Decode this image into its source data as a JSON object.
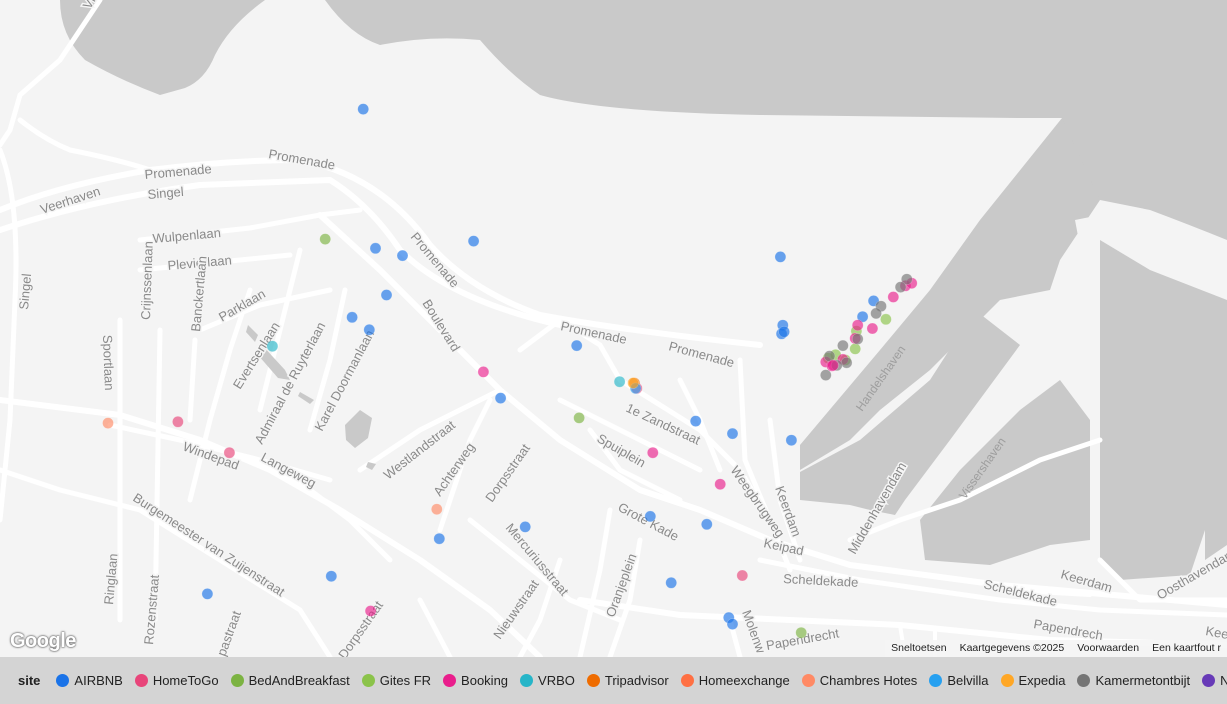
{
  "map": {
    "streets": [
      {
        "name": "Vlissingen",
        "text": "Vlis"
      },
      {
        "name": "Veerhaven",
        "text": "Veerhaven"
      },
      {
        "name": "Promenade-1",
        "text": "Promenade"
      },
      {
        "name": "Promenade-2",
        "text": "Promenade"
      },
      {
        "name": "Singel-1",
        "text": "Singel"
      },
      {
        "name": "Singel-2",
        "text": "Singel"
      },
      {
        "name": "Wulpenlaan",
        "text": "Wulpenlaan"
      },
      {
        "name": "Plevierlaan",
        "text": "Plevierlaan"
      },
      {
        "name": "Parklaan",
        "text": "Parklaan"
      },
      {
        "name": "Promenade-3",
        "text": "Promenade"
      },
      {
        "name": "Promenade-4",
        "text": "Promenade"
      },
      {
        "name": "Promenade-5",
        "text": "Promenade"
      },
      {
        "name": "Boulevard",
        "text": "Boulevard"
      },
      {
        "name": "Evertsenlaan",
        "text": "Evertsenlaan"
      },
      {
        "name": "Admiraal-de-Ruyterlaan",
        "text": "Admiraal de Ruyterlaan"
      },
      {
        "name": "Karel-Doormanlaan",
        "text": "Karel Doormanlaan"
      },
      {
        "name": "Sportlaan",
        "text": "Sportlaan"
      },
      {
        "name": "Crijnssenlaan",
        "text": "Crijnssenlaan"
      },
      {
        "name": "Banckertlaan",
        "text": "Banckertlaan"
      },
      {
        "name": "Windepad",
        "text": "Windepad"
      },
      {
        "name": "Langeweg",
        "text": "Langeweg"
      },
      {
        "name": "Westlandstraat",
        "text": "Westlandstraat"
      },
      {
        "name": "Achterweg",
        "text": "Achterweg"
      },
      {
        "name": "Dorpsstraat-1",
        "text": "Dorpsstraat"
      },
      {
        "name": "1e-Zandstraat",
        "text": "1e Zandstraat"
      },
      {
        "name": "Spuiplein",
        "text": "Spuiplein"
      },
      {
        "name": "Weegbrugweg",
        "text": "Weegbrugweg"
      },
      {
        "name": "Keerdam-1",
        "text": "Keerdam"
      },
      {
        "name": "Grote-Kade",
        "text": "Grote Kade"
      },
      {
        "name": "Keipad",
        "text": "Keipad"
      },
      {
        "name": "Middenhavendam",
        "text": "Middenhavendam"
      },
      {
        "name": "Scheldekade-1",
        "text": "Scheldekade"
      },
      {
        "name": "Scheldekade-2",
        "text": "Scheldekade"
      },
      {
        "name": "Keerdam-2",
        "text": "Keerdam"
      },
      {
        "name": "Oosthavendam",
        "text": "Oosthavendam"
      },
      {
        "name": "Burgemeester-van-Zuijenstraat",
        "text": "Burgemeester van Zuijenstraat"
      },
      {
        "name": "Ringlaan",
        "text": "Ringlaan"
      },
      {
        "name": "Rozenstraat",
        "text": "Rozenstraat"
      },
      {
        "name": "Lupastraat",
        "text": "pastraat"
      },
      {
        "name": "Dorpsstraat-2",
        "text": "Dorpsstraat"
      },
      {
        "name": "Mercuriusstraat",
        "text": "Mercuriusstraat"
      },
      {
        "name": "Nieuwstraat",
        "text": "Nieuwstraat"
      },
      {
        "name": "Oranjeplein",
        "text": "Oranjeplein"
      },
      {
        "name": "Molenweg",
        "text": "Molenw"
      },
      {
        "name": "Papendrecht-1",
        "text": "Papendrecht"
      },
      {
        "name": "Papendrecht-2",
        "text": "Papendrech"
      },
      {
        "name": "Kee",
        "text": "Kee"
      },
      {
        "name": "Handelshaven",
        "text": "Handelshaven"
      },
      {
        "name": "Vissershaven",
        "text": "Vissershaven"
      }
    ],
    "points": [
      {
        "site": "AIRBNB",
        "lat": 0.166,
        "lng": 0.296
      },
      {
        "site": "AIRBNB",
        "lat": 0.378,
        "lng": 0.306
      },
      {
        "site": "AIRBNB",
        "lat": 0.389,
        "lng": 0.328
      },
      {
        "site": "AIRBNB",
        "lat": 0.367,
        "lng": 0.386
      },
      {
        "site": "AIRBNB",
        "lat": 0.449,
        "lng": 0.315
      },
      {
        "site": "AIRBNB",
        "lat": 0.483,
        "lng": 0.287
      },
      {
        "site": "AIRBNB",
        "lat": 0.502,
        "lng": 0.301
      },
      {
        "site": "AIRBNB",
        "lat": 0.526,
        "lng": 0.47
      },
      {
        "site": "AIRBNB",
        "lat": 0.606,
        "lng": 0.408
      },
      {
        "site": "AIRBNB",
        "lat": 0.391,
        "lng": 0.636
      },
      {
        "site": "AIRBNB",
        "lat": 0.495,
        "lng": 0.638
      },
      {
        "site": "AIRBNB",
        "lat": 0.508,
        "lng": 0.637
      },
      {
        "site": "AIRBNB",
        "lat": 0.505,
        "lng": 0.639
      },
      {
        "site": "AIRBNB",
        "lat": 0.458,
        "lng": 0.712
      },
      {
        "site": "AIRBNB",
        "lat": 0.482,
        "lng": 0.703
      },
      {
        "site": "AIRBNB",
        "lat": 0.641,
        "lng": 0.567
      },
      {
        "site": "AIRBNB",
        "lat": 0.66,
        "lng": 0.597
      },
      {
        "site": "AIRBNB",
        "lat": 0.67,
        "lng": 0.645
      },
      {
        "site": "AIRBNB",
        "lat": 0.786,
        "lng": 0.53
      },
      {
        "site": "AIRBNB",
        "lat": 0.798,
        "lng": 0.576
      },
      {
        "site": "AIRBNB",
        "lat": 0.802,
        "lng": 0.428
      },
      {
        "site": "AIRBNB",
        "lat": 0.82,
        "lng": 0.358
      },
      {
        "site": "AIRBNB",
        "lat": 0.877,
        "lng": 0.27
      },
      {
        "site": "AIRBNB",
        "lat": 0.904,
        "lng": 0.169
      },
      {
        "site": "AIRBNB",
        "lat": 0.887,
        "lng": 0.547
      },
      {
        "site": "AIRBNB",
        "lat": 0.94,
        "lng": 0.594
      },
      {
        "site": "AIRBNB",
        "lat": 0.95,
        "lng": 0.597
      },
      {
        "site": "HomeToGo",
        "lat": 0.642,
        "lng": 0.145
      },
      {
        "site": "HomeToGo",
        "lat": 0.689,
        "lng": 0.187
      },
      {
        "site": "HomeToGo",
        "lat": 0.591,
        "lng": 0.519
      },
      {
        "site": "HomeToGo",
        "lat": 0.876,
        "lng": 0.605
      },
      {
        "site": "BedAndBreakfast",
        "lat": 0.364,
        "lng": 0.265
      },
      {
        "site": "BedAndBreakfast",
        "lat": 0.636,
        "lng": 0.472
      },
      {
        "site": "BedAndBreakfast",
        "lat": 0.963,
        "lng": 0.653
      },
      {
        "site": "Booking",
        "lat": 0.737,
        "lng": 0.587
      },
      {
        "site": "Booking",
        "lat": 0.93,
        "lng": 0.302
      },
      {
        "site": "Booking",
        "lat": 0.566,
        "lng": 0.394
      },
      {
        "site": "Booking",
        "lat": 0.689,
        "lng": 0.532
      },
      {
        "site": "VRBO",
        "lat": 0.527,
        "lng": 0.222
      },
      {
        "site": "VRBO",
        "lat": 0.581,
        "lng": 0.505
      },
      {
        "site": "Tripadvisor",
        "lat": 0.583,
        "lng": 0.517
      },
      {
        "site": "Chambres Hotes",
        "lat": 0.644,
        "lng": 0.088
      },
      {
        "site": "Chambres Hotes",
        "lat": 0.775,
        "lng": 0.356
      },
      {
        "site": "Belvilla",
        "lat": 0.591,
        "lng": 0.518
      },
      {
        "site": "Gites FR",
        "lat": 0.486,
        "lng": 0.722
      },
      {
        "site": "Gites FR",
        "lat": 0.531,
        "lng": 0.697
      },
      {
        "site": "Gites FR",
        "lat": 0.548,
        "lng": 0.689
      },
      {
        "site": "Gites FR",
        "lat": 0.504,
        "lng": 0.698
      },
      {
        "site": "Gites FR",
        "lat": 0.545,
        "lng": 0.675
      },
      {
        "site": "Gites FR",
        "lat": 0.54,
        "lng": 0.681
      },
      {
        "site": "Booking",
        "lat": 0.435,
        "lng": 0.738
      },
      {
        "site": "Booking",
        "lat": 0.452,
        "lng": 0.728
      },
      {
        "site": "Booking",
        "lat": 0.495,
        "lng": 0.699
      },
      {
        "site": "Booking",
        "lat": 0.515,
        "lng": 0.697
      },
      {
        "site": "Booking",
        "lat": 0.551,
        "lng": 0.673
      },
      {
        "site": "Booking",
        "lat": 0.557,
        "lng": 0.678
      },
      {
        "site": "Booking",
        "lat": 0.547,
        "lng": 0.687
      },
      {
        "site": "Booking",
        "lat": 0.431,
        "lng": 0.743
      },
      {
        "site": "Kamermetontbijt",
        "lat": 0.425,
        "lng": 0.739
      },
      {
        "site": "Kamermetontbijt",
        "lat": 0.437,
        "lng": 0.734
      },
      {
        "site": "Kamermetontbijt",
        "lat": 0.466,
        "lng": 0.718
      },
      {
        "site": "Kamermetontbijt",
        "lat": 0.477,
        "lng": 0.714
      },
      {
        "site": "Kamermetontbijt",
        "lat": 0.516,
        "lng": 0.699
      },
      {
        "site": "Kamermetontbijt",
        "lat": 0.526,
        "lng": 0.687
      },
      {
        "site": "Kamermetontbijt",
        "lat": 0.542,
        "lng": 0.676
      },
      {
        "site": "Kamermetontbijt",
        "lat": 0.552,
        "lng": 0.69
      },
      {
        "site": "Kamermetontbijt",
        "lat": 0.571,
        "lng": 0.673
      },
      {
        "site": "Kamermetontbijt",
        "lat": 0.556,
        "lng": 0.682
      },
      {
        "site": "Expedia",
        "lat": 0.583,
        "lng": 0.516
      },
      {
        "site": "Booking",
        "lat": 0.5,
        "lng": 0.711
      },
      {
        "site": "Booking",
        "lat": 0.556,
        "lng": 0.679
      }
    ]
  },
  "colors": {
    "AIRBNB": "#1a73e8",
    "HomeToGo": "#e8457a",
    "BedAndBreakfast": "#7cb342",
    "Gites FR": "#8bc34a",
    "Booking": "#e91e8c",
    "VRBO": "#26b5c8",
    "Tripadvisor": "#ef6c00",
    "Homeexchange": "#ff7043",
    "Chambres Hotes": "#ff8a65",
    "Belvilla": "#26a0f0",
    "Expedia": "#ffa726",
    "Kamermetontbijt": "#757575",
    "Natuurhuisje": "#673ab7",
    "blend_red": "#c0504d",
    "blend_olive": "#8d8d44"
  },
  "google_logo": "Google",
  "attribution": {
    "shortcuts": "Sneltoetsen",
    "mapdata": "Kaartgegevens ©2025",
    "terms": "Voorwaarden",
    "report": "Een kaartfout r"
  },
  "legend": {
    "title": "site",
    "items": [
      {
        "label": "AIRBNB",
        "key": "AIRBNB"
      },
      {
        "label": "HomeToGo",
        "key": "HomeToGo"
      },
      {
        "label": "BedAndBreakfast",
        "key": "BedAndBreakfast"
      },
      {
        "label": "Gites FR",
        "key": "Gites FR"
      },
      {
        "label": "Booking",
        "key": "Booking"
      },
      {
        "label": "VRBO",
        "key": "VRBO"
      },
      {
        "label": "Tripadvisor",
        "key": "Tripadvisor"
      },
      {
        "label": "Homeexchange",
        "key": "Homeexchange"
      },
      {
        "label": "Chambres Hotes",
        "key": "Chambres Hotes"
      },
      {
        "label": "Belvilla",
        "key": "Belvilla"
      },
      {
        "label": "Expedia",
        "key": "Expedia"
      },
      {
        "label": "Kamermetontbijt",
        "key": "Kamermetontbijt"
      },
      {
        "label": "Natuu",
        "key": "Natuurhuisje"
      }
    ]
  }
}
